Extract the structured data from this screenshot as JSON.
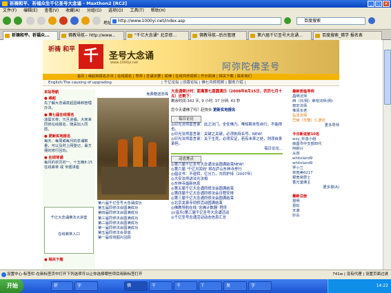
{
  "window": {
    "title": "祈祷和平、祈福众生千亿圣号大念诵 - Maxthon2 [RC2]",
    "controls": [
      "_",
      "□",
      "×"
    ]
  },
  "menu": [
    "文件(F)",
    "编辑(E)",
    "查看(V)",
    "收藏(A)",
    "分组(G)",
    "选项(O)",
    "工具(T)",
    "帮助(H)"
  ],
  "address": {
    "label": "地址",
    "url": "http://www.1000yi.net/index.asp",
    "search_placeholder": "百度搜索"
  },
  "tabs": [
    {
      "label": "祈祷和平、祈福众..."
    },
    {
      "label": "佛教导航-- http://www..."
    },
    {
      "label": "\"千亿大念诵\" 北京修..."
    },
    {
      "label": "佛教导航--后台管理"
    },
    {
      "label": "第六届千亿圣号大念诵..."
    },
    {
      "label": "百度搜索_佛学 报名表"
    }
  ],
  "banner": {
    "pray": "祈祷 和平",
    "big": "千亿",
    "name": "圣号大念诵",
    "url": "www.1000yi.net",
    "right": "阿弥陀佛圣号"
  },
  "nav": {
    "row": "首页 | 缘起和报名办法 | 在线报名 | 导师 | 念诵法要 | 戒律 | 在线共修视频 | 开示阅读 | 相关下载 | 联系我们",
    "english": "English:The causing of upgrading",
    "links": "| 千亿论坛 | 旧版论坛 | 佛七共修视频 | 服务介绍 |"
  },
  "left": {
    "title": "本站导航",
    "sections": [
      {
        "h": "● 缘起",
        "t": "先了解大念诵发起因缘和管理办法。"
      },
      {
        "h": "● 第七届在线报名",
        "t": "凌晨长夜，元旦迎福，大家来同修在线报名，随喜加入同愿。"
      },
      {
        "h": "● 更新实地报名",
        "t": "每天、每周或每月的念诵数量，可以及时上网登记，最方便的修行回向。"
      },
      {
        "h": "● 在线背诵",
        "t": "每月的农历初一、十五晚8:15 在线荟萃 戒 专题讲座"
      }
    ],
    "box_title": "千亿大念诵佛法大讲堂",
    "box_link": "在线荟萃入口",
    "bottom": "● 相关下载"
  },
  "mid": {
    "top_link": "免费赠送念珠",
    "items": [
      "第六届千亿圣号大念诵成功",
      "第五届同修法会圆满成功",
      "第四届同修法会圆满成功",
      "第三届同修法会圆满成功",
      "第二届同修法会圆满成功",
      "第一届同修法会圆满成功",
      "第五届同修法会录音",
      "第一届现场图片回顾"
    ]
  },
  "center": {
    "head1": "大念诵倒计时：距离第七届圆满日（2008年8月15日，农历七月十五）还剩下：",
    "remaining": "剩余时间:342 天, 9 小时, 37 分钟, 43 秒",
    "question": "您今天诵佛了吗？赶快去",
    "question_link": "更新实地报名",
    "box1": "每日论论",
    "box1_items": [
      "◎印光法师嘉言录：此之法门，全仗佛力。唯知赖本性自行，不能得也。",
      "◎印光法师嘉言录：关键之关键，必须执持名号。NEW!",
      "◎印光法师嘉言录：关于生死，必须实证，若有未来之处，则须自身承担。"
    ],
    "box1_more": "每日论论...",
    "box2": "动态焦点",
    "box2_items": [
      "◎第六届千亿圣号大念诵法会圆满结束NEW!",
      "◎第六届 '千亿大回向' 将在庐山东林寺举行",
      "◎倡议书：不退转，亿分力，共同护持（2007年）",
      "◎大安法师讲法光法相",
      "◎东林寺最新信息",
      "◎第五届千亿大念诵同修法会圆满结束",
      "◎第四届千亿大念诵同修法会日程安排",
      "◎第三届千亿大念诵同修法会圆满结束",
      "◎北京龙泉寺同修活动圆满结束",
      "◎佛教导航在线 '念佛计数器' 程序",
      "◎(音乐)第三届千亿圣号大念诵活动",
      "◎千亿圣号念诵活动动态信息汇总"
    ]
  },
  "right": {
    "title": "最新若临导师",
    "items": [
      "昌明法师",
      "西（日/网）荣增法师(网)",
      "慈宏法师",
      "惟贤长老",
      "弘法法师",
      "巴琼（华智）仁波切"
    ],
    "more1": "更多导师",
    "title2": "今日新进前10名",
    "list2": [
      "wxy_妙音小组",
      "南昌市中支部四代",
      "阿颜兴",
      "从容",
      "whiteland9",
      "whiteland9",
      "罗小兰",
      "林宽美6217",
      "释宽常居士",
      "香光室佛主"
    ],
    "more2": "更多报(A)",
    "title3": "最新注册",
    "list3": [
      "慧明",
      "慧松",
      "天谢",
      "妙白"
    ]
  },
  "status": {
    "text": "设置中心-标签栏-在新标签页中打开下列选项可以让你选择哪些项目用新标签打开",
    "right": "741w | 没有代理 | 设置页面过滤"
  },
  "taskbar": {
    "start": "开始",
    "buttons": [
      "祈",
      "字",
      "佛",
      "千",
      "千",
      "T",
      "发",
      "字"
    ],
    "clock": "14:22"
  }
}
